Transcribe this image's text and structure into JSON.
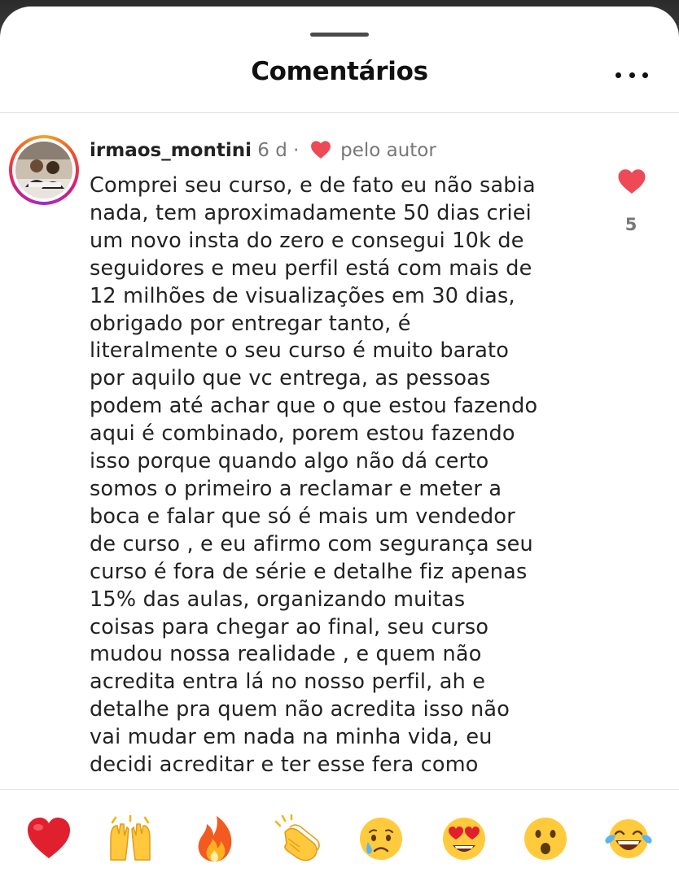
{
  "header": {
    "title": "Comentários"
  },
  "comment": {
    "username": "irmaos_montini",
    "time": "6 d",
    "separator": "·",
    "liked_by_author": "pelo autor",
    "text": "Comprei seu curso, e de fato eu não sabia\nnada, tem aproximadamente 50 dias criei\num novo insta do zero e consegui 10k de\nseguidores e meu perfil está com mais de\n12 milhões de visualizações em 30 dias,\nobrigado por entregar tanto, é\nliteralmente o seu curso é muito barato\npor aquilo que vc entrega, as pessoas\npodem até achar que o que estou fazendo\naqui é combinado, porem estou fazendo\nisso porque quando algo não dá certo\nsomos o primeiro a reclamar e meter a\nboca e falar que só é mais um vendedor\nde curso , e eu afirmo com segurança seu\ncurso é fora de série e detalhe fiz apenas\n15% das aulas, organizando muitas\ncoisas para chegar ao final, seu curso\nmudou nossa realidade , e quem não\nacredita entra lá no nosso perfil, ah e\ndetalhe pra quem não acredita isso não\nvai mudar em nada na minha vida, eu\ndecidi acreditar e ter esse fera como",
    "like_count": "5"
  },
  "emoji_reactions": [
    "red-heart",
    "raising-hands",
    "fire",
    "clapping-hands",
    "crying-face",
    "heart-eyes-face",
    "surprised-face",
    "tears-of-joy-face"
  ],
  "colors": {
    "like_red": "#ed4956",
    "username": "#222222",
    "meta_gray": "#777777"
  }
}
